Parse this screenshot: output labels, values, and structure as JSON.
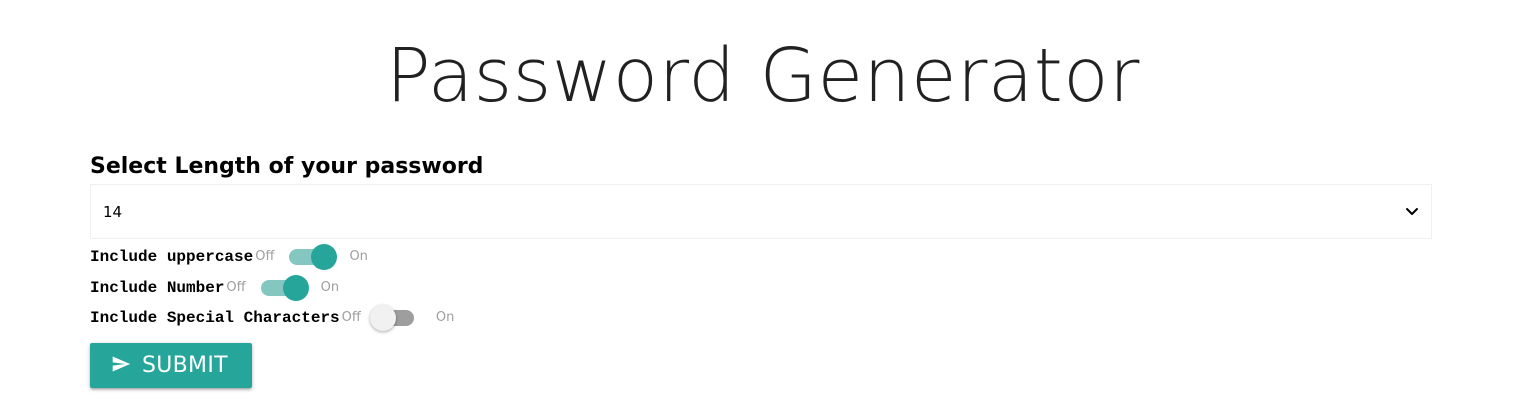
{
  "page": {
    "title": "Password Generator"
  },
  "form": {
    "length_label": "Select Length of your password",
    "length_select": {
      "selected_value": "14",
      "icon": "chevron-down-icon"
    },
    "options": [
      {
        "label": "Include uppercase",
        "off_text": "Off",
        "on_text": "On",
        "checked": true
      },
      {
        "label": "Include Number",
        "off_text": "Off",
        "on_text": "On",
        "checked": true
      },
      {
        "label": "Include Special Characters",
        "off_text": "Off",
        "on_text": "On",
        "checked": false
      }
    ],
    "submit": {
      "label": "SUBMIT",
      "icon": "send-icon"
    }
  },
  "colors": {
    "accent": "#26a69a",
    "switch_track_on": "#84c7c1",
    "switch_track_off": "#9e9e9e",
    "muted_text": "#9e9e9e"
  }
}
